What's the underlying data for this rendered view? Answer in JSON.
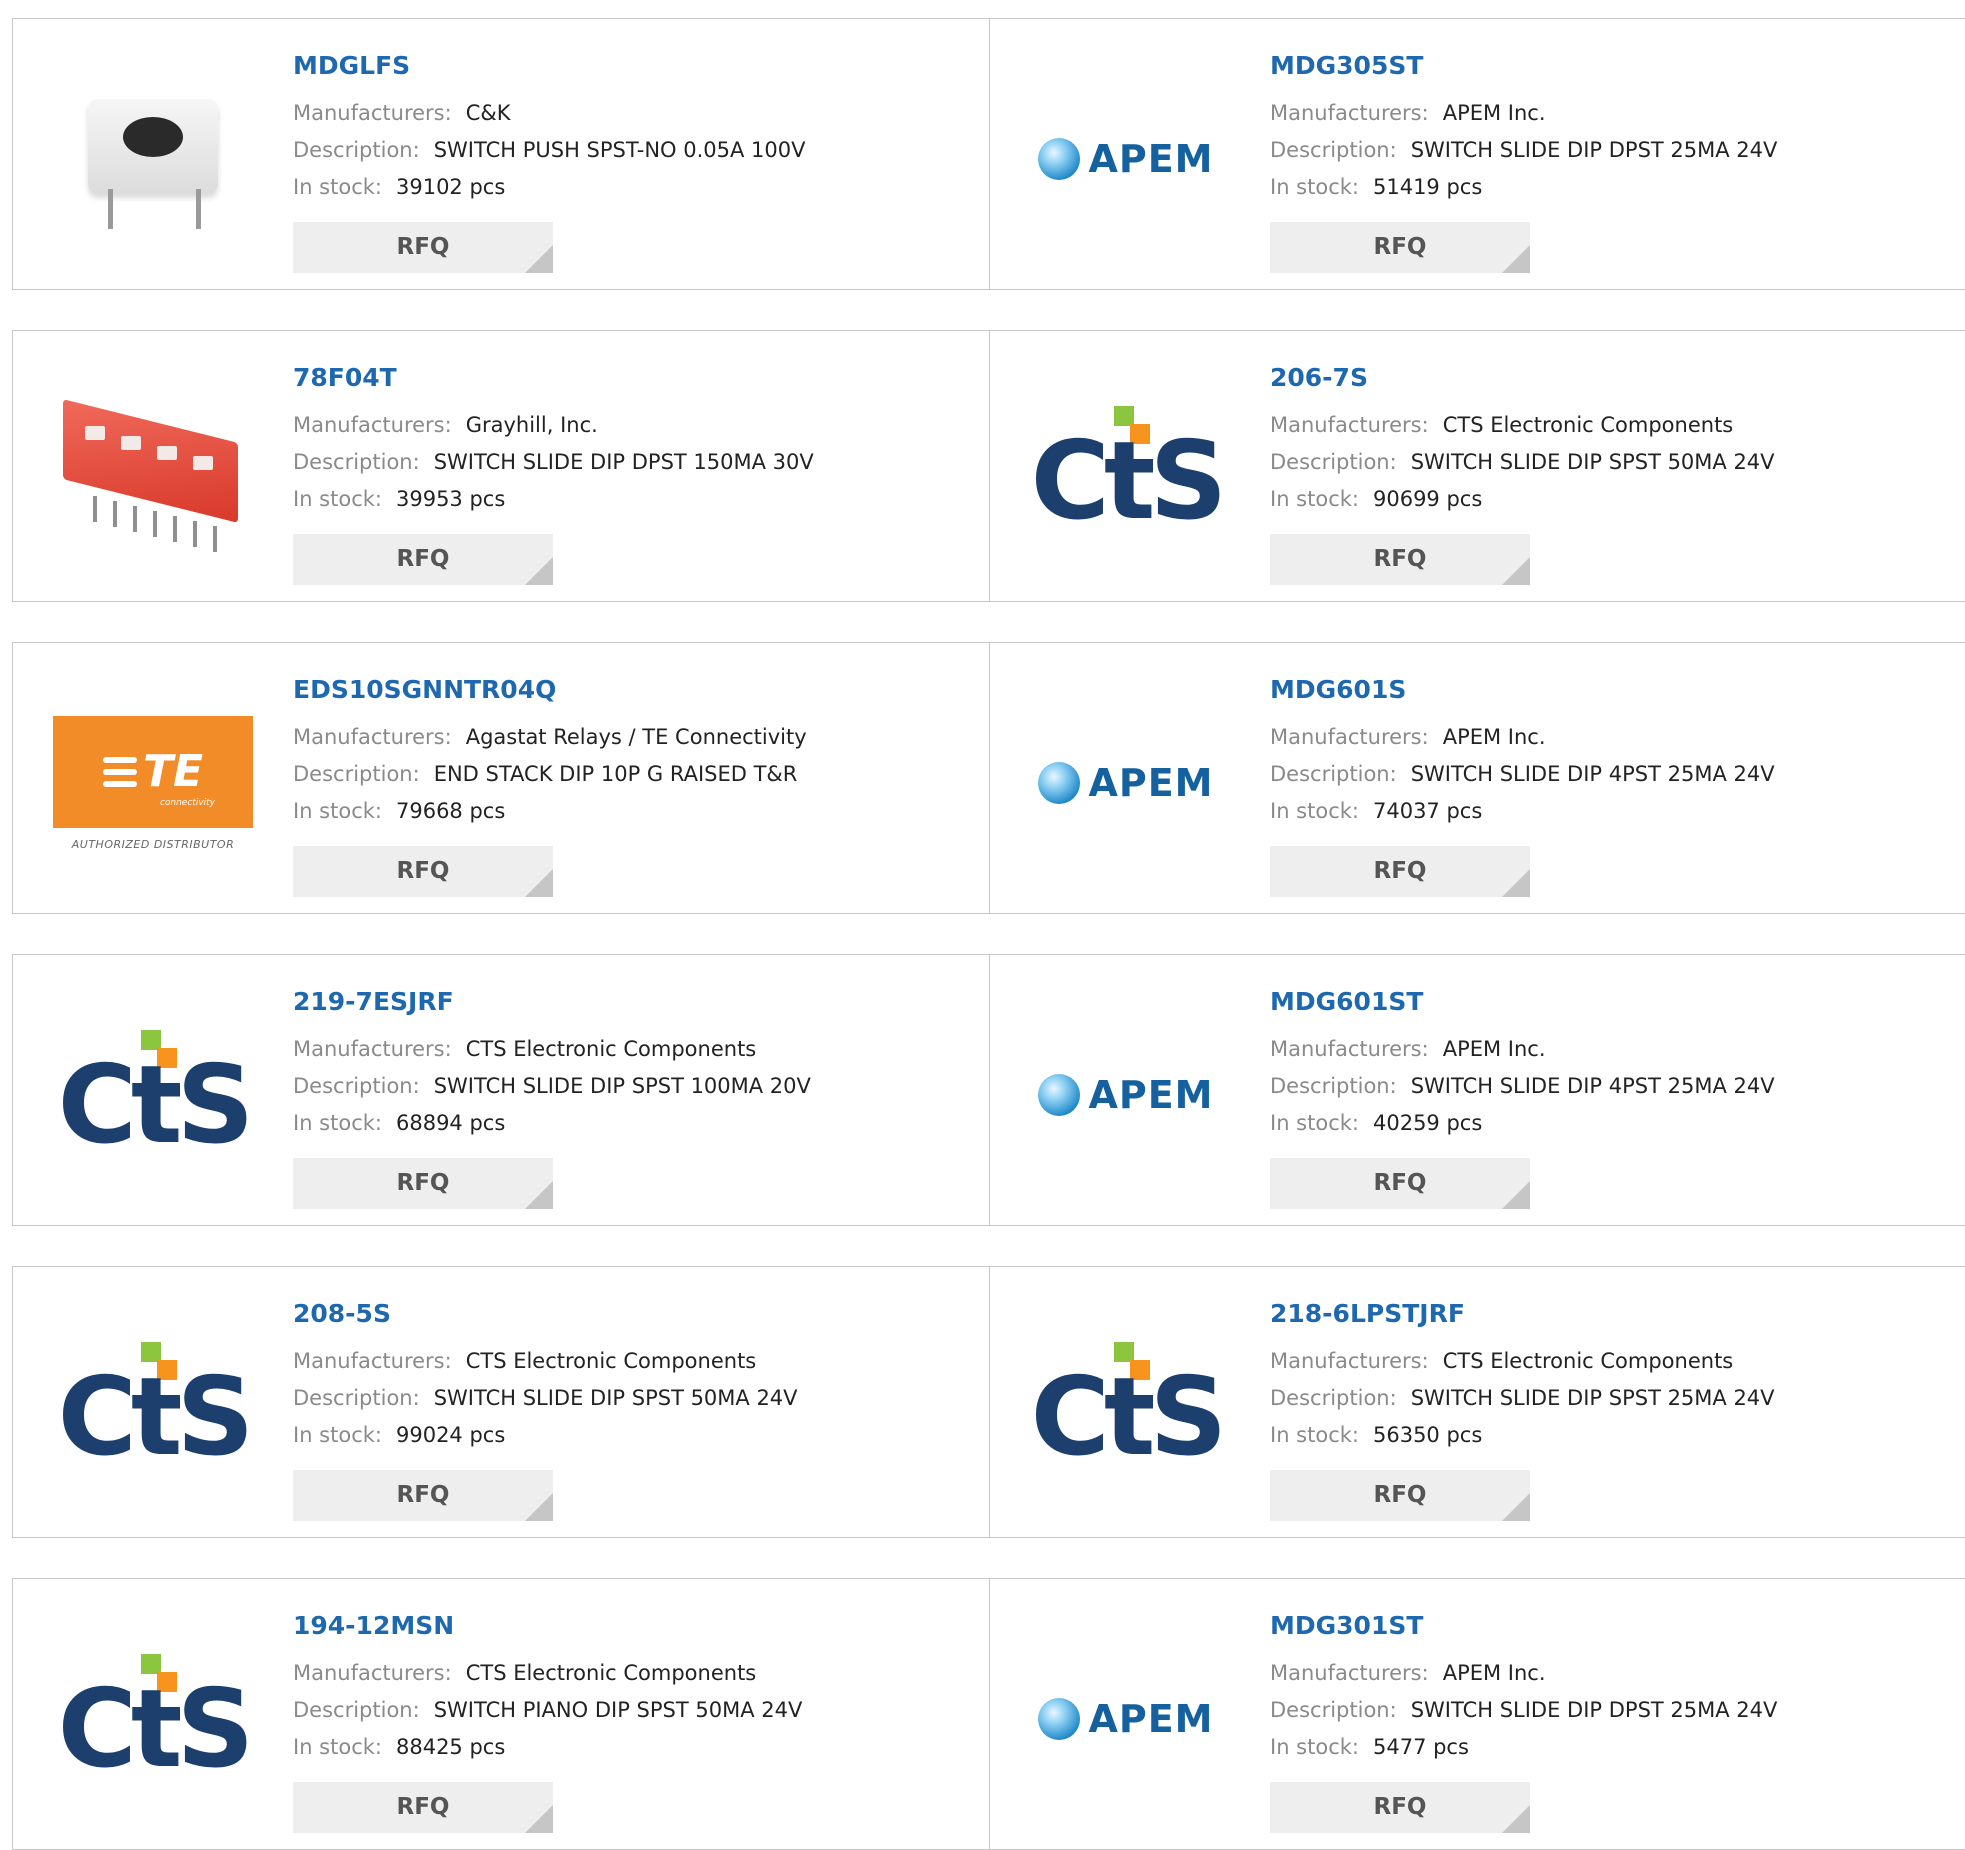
{
  "labels": {
    "manufacturers": "Manufacturers:",
    "description": "Description:",
    "stock": "In stock:",
    "rfq": "RFQ"
  },
  "products": [
    {
      "part": "MDGLFS",
      "manufacturer": "C&K",
      "description": "SWITCH PUSH SPST-NO 0.05A 100V",
      "stock": "39102 pcs",
      "image": "push-switch-photo"
    },
    {
      "part": "MDG305ST",
      "manufacturer": "APEM Inc.",
      "description": "SWITCH SLIDE DIP DPST 25MA 24V",
      "stock": "51419 pcs",
      "image": "apem-logo"
    },
    {
      "part": "78F04T",
      "manufacturer": "Grayhill, Inc.",
      "description": "SWITCH SLIDE DIP DPST 150MA 30V",
      "stock": "39953 pcs",
      "image": "dip-switch-photo"
    },
    {
      "part": "206-7S",
      "manufacturer": "CTS Electronic Components",
      "description": "SWITCH SLIDE DIP SPST 50MA 24V",
      "stock": "90699 pcs",
      "image": "cts-logo"
    },
    {
      "part": "EDS10SGNNTR04Q",
      "manufacturer": "Agastat Relays / TE Connectivity",
      "description": "END STACK DIP 10P G RAISED T&R",
      "stock": "79668 pcs",
      "image": "te-logo"
    },
    {
      "part": "MDG601S",
      "manufacturer": "APEM Inc.",
      "description": "SWITCH SLIDE DIP 4PST 25MA 24V",
      "stock": "74037 pcs",
      "image": "apem-logo"
    },
    {
      "part": "219-7ESJRF",
      "manufacturer": "CTS Electronic Components",
      "description": "SWITCH SLIDE DIP SPST 100MA 20V",
      "stock": "68894 pcs",
      "image": "cts-logo"
    },
    {
      "part": "MDG601ST",
      "manufacturer": "APEM Inc.",
      "description": "SWITCH SLIDE DIP 4PST 25MA 24V",
      "stock": "40259 pcs",
      "image": "apem-logo"
    },
    {
      "part": "208-5S",
      "manufacturer": "CTS Electronic Components",
      "description": "SWITCH SLIDE DIP SPST 50MA 24V",
      "stock": "99024 pcs",
      "image": "cts-logo"
    },
    {
      "part": "218-6LPSTJRF",
      "manufacturer": "CTS Electronic Components",
      "description": "SWITCH SLIDE DIP SPST 25MA 24V",
      "stock": "56350 pcs",
      "image": "cts-logo"
    },
    {
      "part": "194-12MSN",
      "manufacturer": "CTS Electronic Components",
      "description": "SWITCH PIANO DIP SPST 50MA 24V",
      "stock": "88425 pcs",
      "image": "cts-logo"
    },
    {
      "part": "MDG301ST",
      "manufacturer": "APEM Inc.",
      "description": "SWITCH SLIDE DIP DPST 25MA 24V",
      "stock": "5477 pcs",
      "image": "apem-logo"
    }
  ],
  "logos": {
    "apem": "APEM",
    "cts": "CtS",
    "te": "TE",
    "te_sub": "connectivity",
    "te_auth": "AUTHORIZED DISTRIBUTOR"
  },
  "colors": {
    "part_link": "#1e68b0",
    "label": "#8a8a8a",
    "rfq_bg": "#eeeeee",
    "border": "#c9c9c9"
  }
}
